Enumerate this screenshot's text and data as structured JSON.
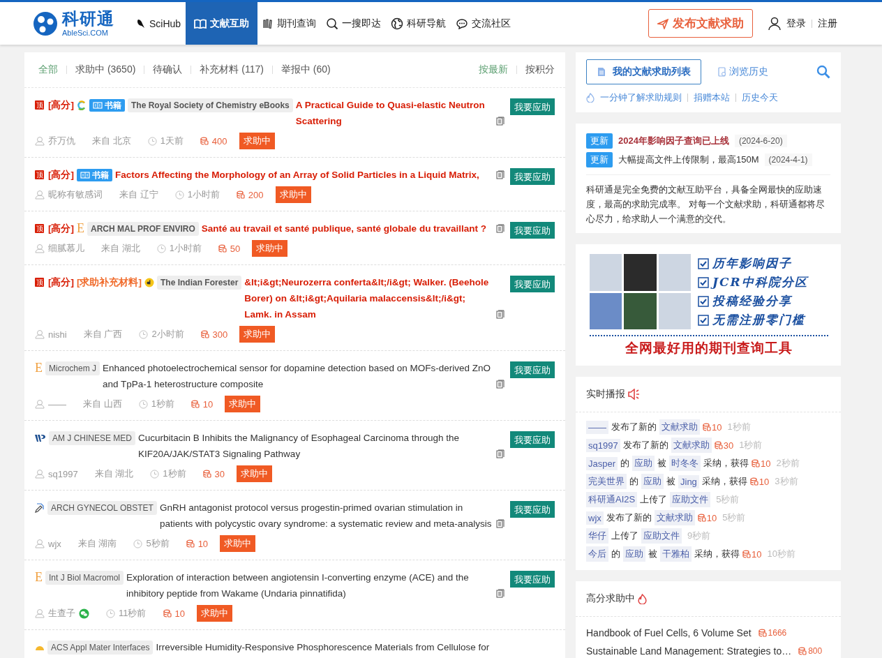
{
  "header": {
    "logo": {
      "name": "科研通",
      "domain": "AbleSci.COM"
    },
    "nav": [
      {
        "label": "SciHub",
        "selected": false
      },
      {
        "label": "文献互助",
        "selected": true
      },
      {
        "label": "期刊查询",
        "selected": false
      },
      {
        "label": "一搜即达",
        "selected": false
      },
      {
        "label": "科研导航",
        "selected": false
      },
      {
        "label": "交流社区",
        "selected": false
      }
    ],
    "publish_button": "发布文献求助",
    "login": "登录",
    "register": "注册"
  },
  "filters": {
    "tabs": [
      {
        "label": "全部",
        "selected": true
      },
      {
        "label": "求助中 (3650)",
        "selected": false
      },
      {
        "label": "待确认",
        "selected": false
      },
      {
        "label": "补充材料 (117)",
        "selected": false
      },
      {
        "label": "举报中 (60)",
        "selected": false
      }
    ],
    "sort": [
      {
        "label": "按最新",
        "selected": true
      },
      {
        "label": "按积分",
        "selected": false
      }
    ]
  },
  "requests": [
    {
      "pin": "顶",
      "tags": [
        {
          "text": "[高分]",
          "kind": "score"
        }
      ],
      "source": {
        "kind": "ring"
      },
      "category": "书籍",
      "journal": "The Royal Society of Chemistry eBooks",
      "title": "A Practical Guide to Quasi-elastic Neutron Scattering",
      "highlighted": true,
      "user": "乔万仇",
      "location": "来自 北京",
      "time": "1天前",
      "points": "400",
      "status": "求助中",
      "action": "我要应助"
    },
    {
      "pin": "顶",
      "tags": [
        {
          "text": "[高分]",
          "kind": "score"
        }
      ],
      "category": "书籍",
      "title": "Factors Affecting the Morphology of an Array of Solid Particles in a Liquid Matrix,",
      "highlighted": true,
      "user": "昵称有敏感词",
      "location": "来自 辽宁",
      "time": "1小时前",
      "points": "200",
      "status": "求助中",
      "action": "我要应助"
    },
    {
      "pin": "顶",
      "tags": [
        {
          "text": "[高分]",
          "kind": "score"
        }
      ],
      "source": {
        "kind": "letter",
        "text": "E"
      },
      "journal": "ARCH MAL PROF ENVIRO",
      "title": "Santé au travail et santé publique, santé globale du travaillant ?",
      "highlighted": true,
      "user": "细腻慕儿",
      "location": "来自 湖北",
      "time": "1小时前",
      "points": "50",
      "status": "求助中",
      "action": "我要应助"
    },
    {
      "pin": "顶",
      "tags": [
        {
          "text": "[高分]",
          "kind": "score"
        },
        {
          "text": "[求助补充材料]",
          "kind": "supplement"
        }
      ],
      "source": {
        "kind": "doi"
      },
      "journal": "The Indian Forester",
      "title": "&lt;i&gt;Neurozerra conferta&lt;/i&gt; Walker. (Beehole Borer) on &lt;i&gt;Aquilaria malaccensis&lt;/i&gt; Lamk. in Assam",
      "highlighted": true,
      "user": "nishi",
      "location": "来自 广西",
      "time": "2小时前",
      "points": "300",
      "status": "求助中",
      "action": "我要应助"
    },
    {
      "source": {
        "kind": "letter",
        "text": "E"
      },
      "journal": "Microchem J",
      "title": "Enhanced photoelectrochemical sensor for dopamine detection based on MOFs-derived ZnO and TpPa-1 heterostructure composite",
      "highlighted": false,
      "user": "——",
      "location": "来自 山西",
      "time": "1秒前",
      "points": "10",
      "status": "求助中",
      "action": "我要应助"
    },
    {
      "source": {
        "kind": "wp"
      },
      "journal": "AM J CHINESE MED",
      "title": "Cucurbitacin B Inhibits the Malignancy of Esophageal Carcinoma through the KIF20A/JAK/STAT3 Signaling Pathway",
      "highlighted": false,
      "user": "sq1997",
      "location": "来自 湖北",
      "time": "1秒前",
      "points": "30",
      "status": "求助中",
      "action": "我要应助"
    },
    {
      "source": {
        "kind": "pen"
      },
      "journal": "ARCH GYNECOL OBSTET",
      "title": "GnRH antagonist protocol versus progestin-primed ovarian stimulation in patients with polycystic ovary syndrome: a systematic review and meta-analysis",
      "highlighted": false,
      "user": "wjx",
      "location": "来自 湖南",
      "time": "5秒前",
      "points": "10",
      "status": "求助中",
      "action": "我要应助"
    },
    {
      "source": {
        "kind": "letter",
        "text": "E"
      },
      "journal": "Int J Biol Macromol",
      "title": "Exploration of interaction between angiotensin I-converting enzyme (ACE) and the inhibitory peptide from Wakame (Undaria pinnatifida)",
      "highlighted": false,
      "user": "生查子",
      "wechat": true,
      "time": "11秒前",
      "points": "10",
      "status": "求助中",
      "action": "我要应助"
    },
    {
      "source": {
        "kind": "hat"
      },
      "journal": "ACS Appl Mater Interfaces",
      "title": "Irreversible Humidity-Responsive Phosphorescence Materials from Cellulose for",
      "highlighted": false
    }
  ],
  "sidebar": {
    "my_list_button": "我的文献求助列表",
    "history_link": "浏览历史",
    "links": [
      "一分钟了解求助规则",
      "捐赠本站",
      "历史今天"
    ],
    "updates": [
      {
        "badge": "更新",
        "text": "2024年影响因子查询已上线",
        "date": "(2024-6-20)",
        "highlighted": true
      },
      {
        "badge": "更新",
        "text": "大幅提高文件上传限制，最高150M",
        "date": "(2024-4-1)",
        "highlighted": false
      }
    ],
    "intro": "科研通是完全免费的文献互助平台，具备全网最快的应助速度，最高的求助完成率。 对每一个文献求助，科研通都将尽心尽力，给求助人一个满意的交代。",
    "banner": {
      "features": [
        "历年影响因子",
        "JCR中科院分区",
        "投稿经验分享",
        "无需注册零门槛"
      ],
      "slogan": "全网最好用的期刊查询工具"
    },
    "live_feed": {
      "title": "实时播报",
      "items": [
        [
          {
            "text": "——",
            "kind": "chip"
          },
          {
            "text": "发布了新的",
            "kind": "plain"
          },
          {
            "text": "文献求助",
            "kind": "chip"
          },
          {
            "text": "10",
            "kind": "points"
          },
          {
            "text": "1秒前",
            "kind": "time"
          }
        ],
        [
          {
            "text": "sq1997",
            "kind": "chip"
          },
          {
            "text": "发布了新的",
            "kind": "plain"
          },
          {
            "text": "文献求助",
            "kind": "chip"
          },
          {
            "text": "30",
            "kind": "points"
          },
          {
            "text": "1秒前",
            "kind": "time"
          }
        ],
        [
          {
            "text": "Jasper",
            "kind": "chip"
          },
          {
            "text": "的",
            "kind": "plain"
          },
          {
            "text": "应助",
            "kind": "chip"
          },
          {
            "text": "被",
            "kind": "plain"
          },
          {
            "text": "时冬冬",
            "kind": "chip"
          },
          {
            "text": "采纳，获得",
            "kind": "plain"
          },
          {
            "text": "10",
            "kind": "points"
          },
          {
            "text": "2秒前",
            "kind": "time"
          }
        ],
        [
          {
            "text": "完美世界",
            "kind": "chip"
          },
          {
            "text": "的",
            "kind": "plain"
          },
          {
            "text": "应助",
            "kind": "chip"
          },
          {
            "text": "被",
            "kind": "plain"
          },
          {
            "text": "Jing",
            "kind": "chip"
          },
          {
            "text": "采纳，获得",
            "kind": "plain"
          },
          {
            "text": "10",
            "kind": "points"
          },
          {
            "text": "3秒前",
            "kind": "time"
          }
        ],
        [
          {
            "text": "科研通AI2S",
            "kind": "chip"
          },
          {
            "text": "上传了",
            "kind": "plain"
          },
          {
            "text": "应助文件",
            "kind": "chip"
          },
          {
            "text": "5秒前",
            "kind": "time"
          }
        ],
        [
          {
            "text": "wjx",
            "kind": "chip"
          },
          {
            "text": "发布了新的",
            "kind": "plain"
          },
          {
            "text": "文献求助",
            "kind": "chip"
          },
          {
            "text": "10",
            "kind": "points"
          },
          {
            "text": "5秒前",
            "kind": "time"
          }
        ],
        [
          {
            "text": "华仔",
            "kind": "chip"
          },
          {
            "text": "上传了",
            "kind": "plain"
          },
          {
            "text": "应助文件",
            "kind": "chip"
          },
          {
            "text": "9秒前",
            "kind": "time"
          }
        ],
        [
          {
            "text": "今后",
            "kind": "chip"
          },
          {
            "text": "的",
            "kind": "plain"
          },
          {
            "text": "应助",
            "kind": "chip"
          },
          {
            "text": "被",
            "kind": "plain"
          },
          {
            "text": "干雅柏",
            "kind": "chip"
          },
          {
            "text": "采纳，获得",
            "kind": "plain"
          },
          {
            "text": "10",
            "kind": "points"
          },
          {
            "text": "10秒前",
            "kind": "time"
          }
        ]
      ]
    },
    "high_score": {
      "title": "高分求助中",
      "items": [
        {
          "title": "Handbook of Fuel Cells, 6 Volume Set",
          "points": "1666"
        },
        {
          "title": "Sustainable Land Management: Strategies to…",
          "points": "800"
        }
      ]
    }
  }
}
